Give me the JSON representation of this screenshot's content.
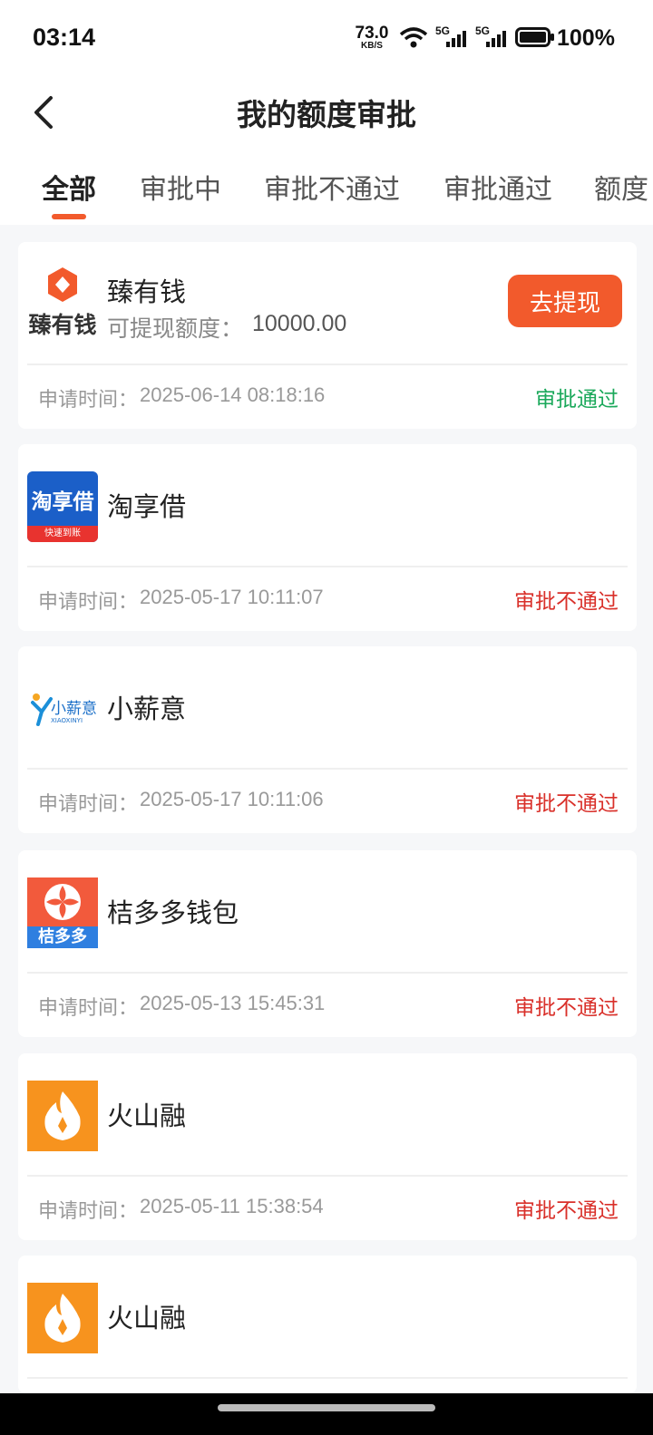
{
  "status_bar": {
    "time": "03:14",
    "net_speed_value": "73.0",
    "net_speed_unit": "KB/S",
    "battery_percent": "100%",
    "icons": [
      "wifi-icon",
      "5g-signal-icon",
      "5g-signal-icon",
      "battery-icon"
    ]
  },
  "header": {
    "title": "我的额度审批",
    "back_icon": "chevron-left-icon"
  },
  "tabs": [
    "全部",
    "审批中",
    "审批不通过",
    "审批通过",
    "额度"
  ],
  "active_tab": 0,
  "labels": {
    "apply_time": "申请时间：",
    "quota": "可提现额度："
  },
  "cards": [
    {
      "name": "臻有钱",
      "logo_text": "臻有钱",
      "quota_value": "10000.00",
      "button_label": "去提现",
      "time": "2025-06-14 08:18:16",
      "status": "审批通过",
      "status_color": "#1aa85a"
    },
    {
      "name": "淘享借",
      "logo_text": "淘享借",
      "logo_subtext": "快速到账",
      "time": "2025-05-17 10:11:07",
      "status": "审批不通过",
      "status_color": "#d9302a"
    },
    {
      "name": "小薪意",
      "logo_text": "小薪意",
      "logo_subtext": "XIAOXINYI",
      "time": "2025-05-17 10:11:06",
      "status": "审批不通过",
      "status_color": "#d9302a"
    },
    {
      "name": "桔多多钱包",
      "logo_text": "桔多多",
      "time": "2025-05-13 15:45:31",
      "status": "审批不通过",
      "status_color": "#d9302a"
    },
    {
      "name": "火山融",
      "time": "2025-05-11 15:38:54",
      "status": "审批不通过",
      "status_color": "#d9302a"
    },
    {
      "name": "火山融"
    }
  ],
  "colors": {
    "accent": "#f25a2c",
    "approved": "#1aa85a",
    "rejected": "#d9302a"
  }
}
